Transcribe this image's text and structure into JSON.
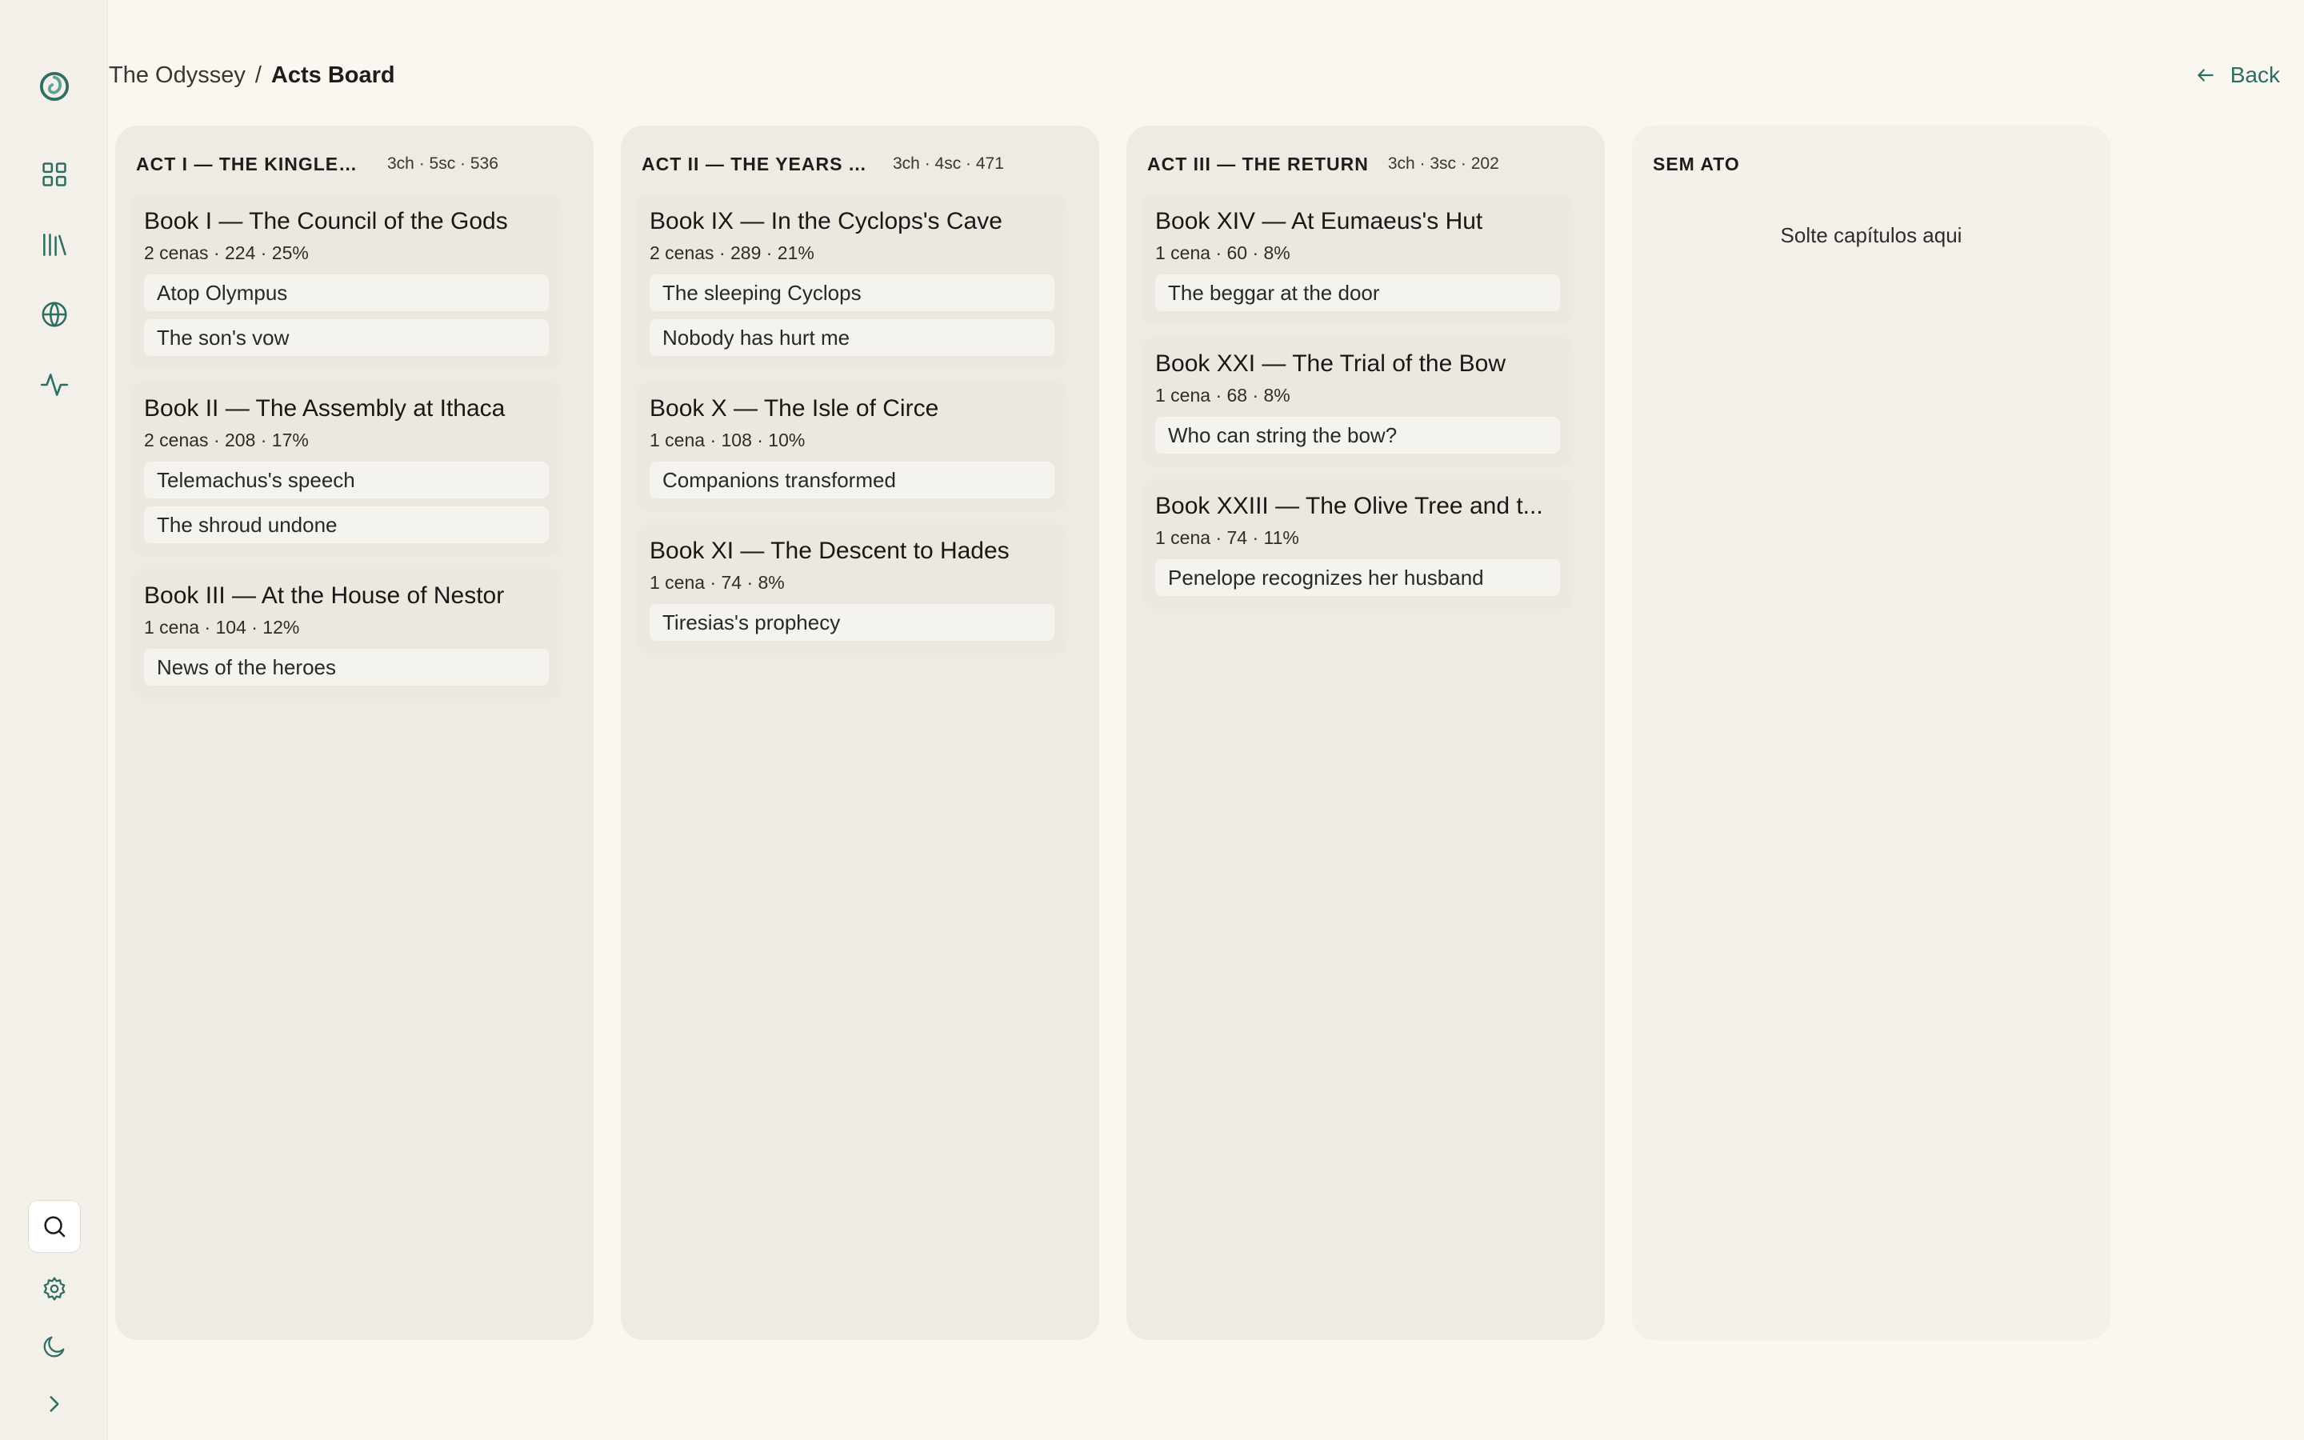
{
  "rail": {
    "items": [
      "logo-icon",
      "dashboard-icon",
      "library-icon",
      "globe-icon",
      "activity-icon"
    ],
    "bottom": [
      "search-icon",
      "settings-icon",
      "moon-icon",
      "chevron-right-icon"
    ]
  },
  "breadcrumb": {
    "root": "The Odyssey",
    "separator": "/",
    "current": "Acts Board"
  },
  "back": {
    "label": "Back"
  },
  "columns": [
    {
      "title": "ACT I — THE KINGLES...",
      "stats": "3ch · 5sc · 536",
      "chapters": [
        {
          "title": "Book I — The Council of the Gods",
          "meta": "2 cenas · 224 · 25%",
          "scenes": [
            "Atop Olympus",
            "The son's vow"
          ]
        },
        {
          "title": "Book II — The Assembly at Ithaca",
          "meta": "2 cenas · 208 · 17%",
          "scenes": [
            "Telemachus's speech",
            "The shroud undone"
          ]
        },
        {
          "title": "Book III — At the House of Nestor",
          "meta": "1 cena · 104 · 12%",
          "scenes": [
            "News of the heroes"
          ]
        }
      ]
    },
    {
      "title": "ACT II — THE YEARS A...",
      "stats": "3ch · 4sc · 471",
      "chapters": [
        {
          "title": "Book IX — In the Cyclops's Cave",
          "meta": "2 cenas · 289 · 21%",
          "scenes": [
            "The sleeping Cyclops",
            "Nobody has hurt me"
          ]
        },
        {
          "title": "Book X — The Isle of Circe",
          "meta": "1 cena · 108 · 10%",
          "scenes": [
            "Companions transformed"
          ]
        },
        {
          "title": "Book XI — The Descent to Hades",
          "meta": "1 cena · 74 · 8%",
          "scenes": [
            "Tiresias's prophecy"
          ]
        }
      ]
    },
    {
      "title": "ACT III — THE RETURN",
      "stats": "3ch · 3sc · 202",
      "chapters": [
        {
          "title": "Book XIV — At Eumaeus's Hut",
          "meta": "1 cena · 60 · 8%",
          "scenes": [
            "The beggar at the door"
          ]
        },
        {
          "title": "Book XXI — The Trial of the Bow",
          "meta": "1 cena · 68 · 8%",
          "scenes": [
            "Who can string the bow?"
          ]
        },
        {
          "title": "Book XXIII — The Olive Tree and t...",
          "meta": "1 cena · 74 · 11%",
          "scenes": [
            "Penelope recognizes her husband"
          ]
        }
      ]
    }
  ],
  "unassigned": {
    "title": "SEM ATO",
    "drop_hint": "Solte capítulos aqui"
  },
  "colors": {
    "accent": "#2e6e62",
    "background": "#faf7f1",
    "column": "#efebe4",
    "card": "#ece8e0",
    "scene": "#f5f3ee"
  }
}
